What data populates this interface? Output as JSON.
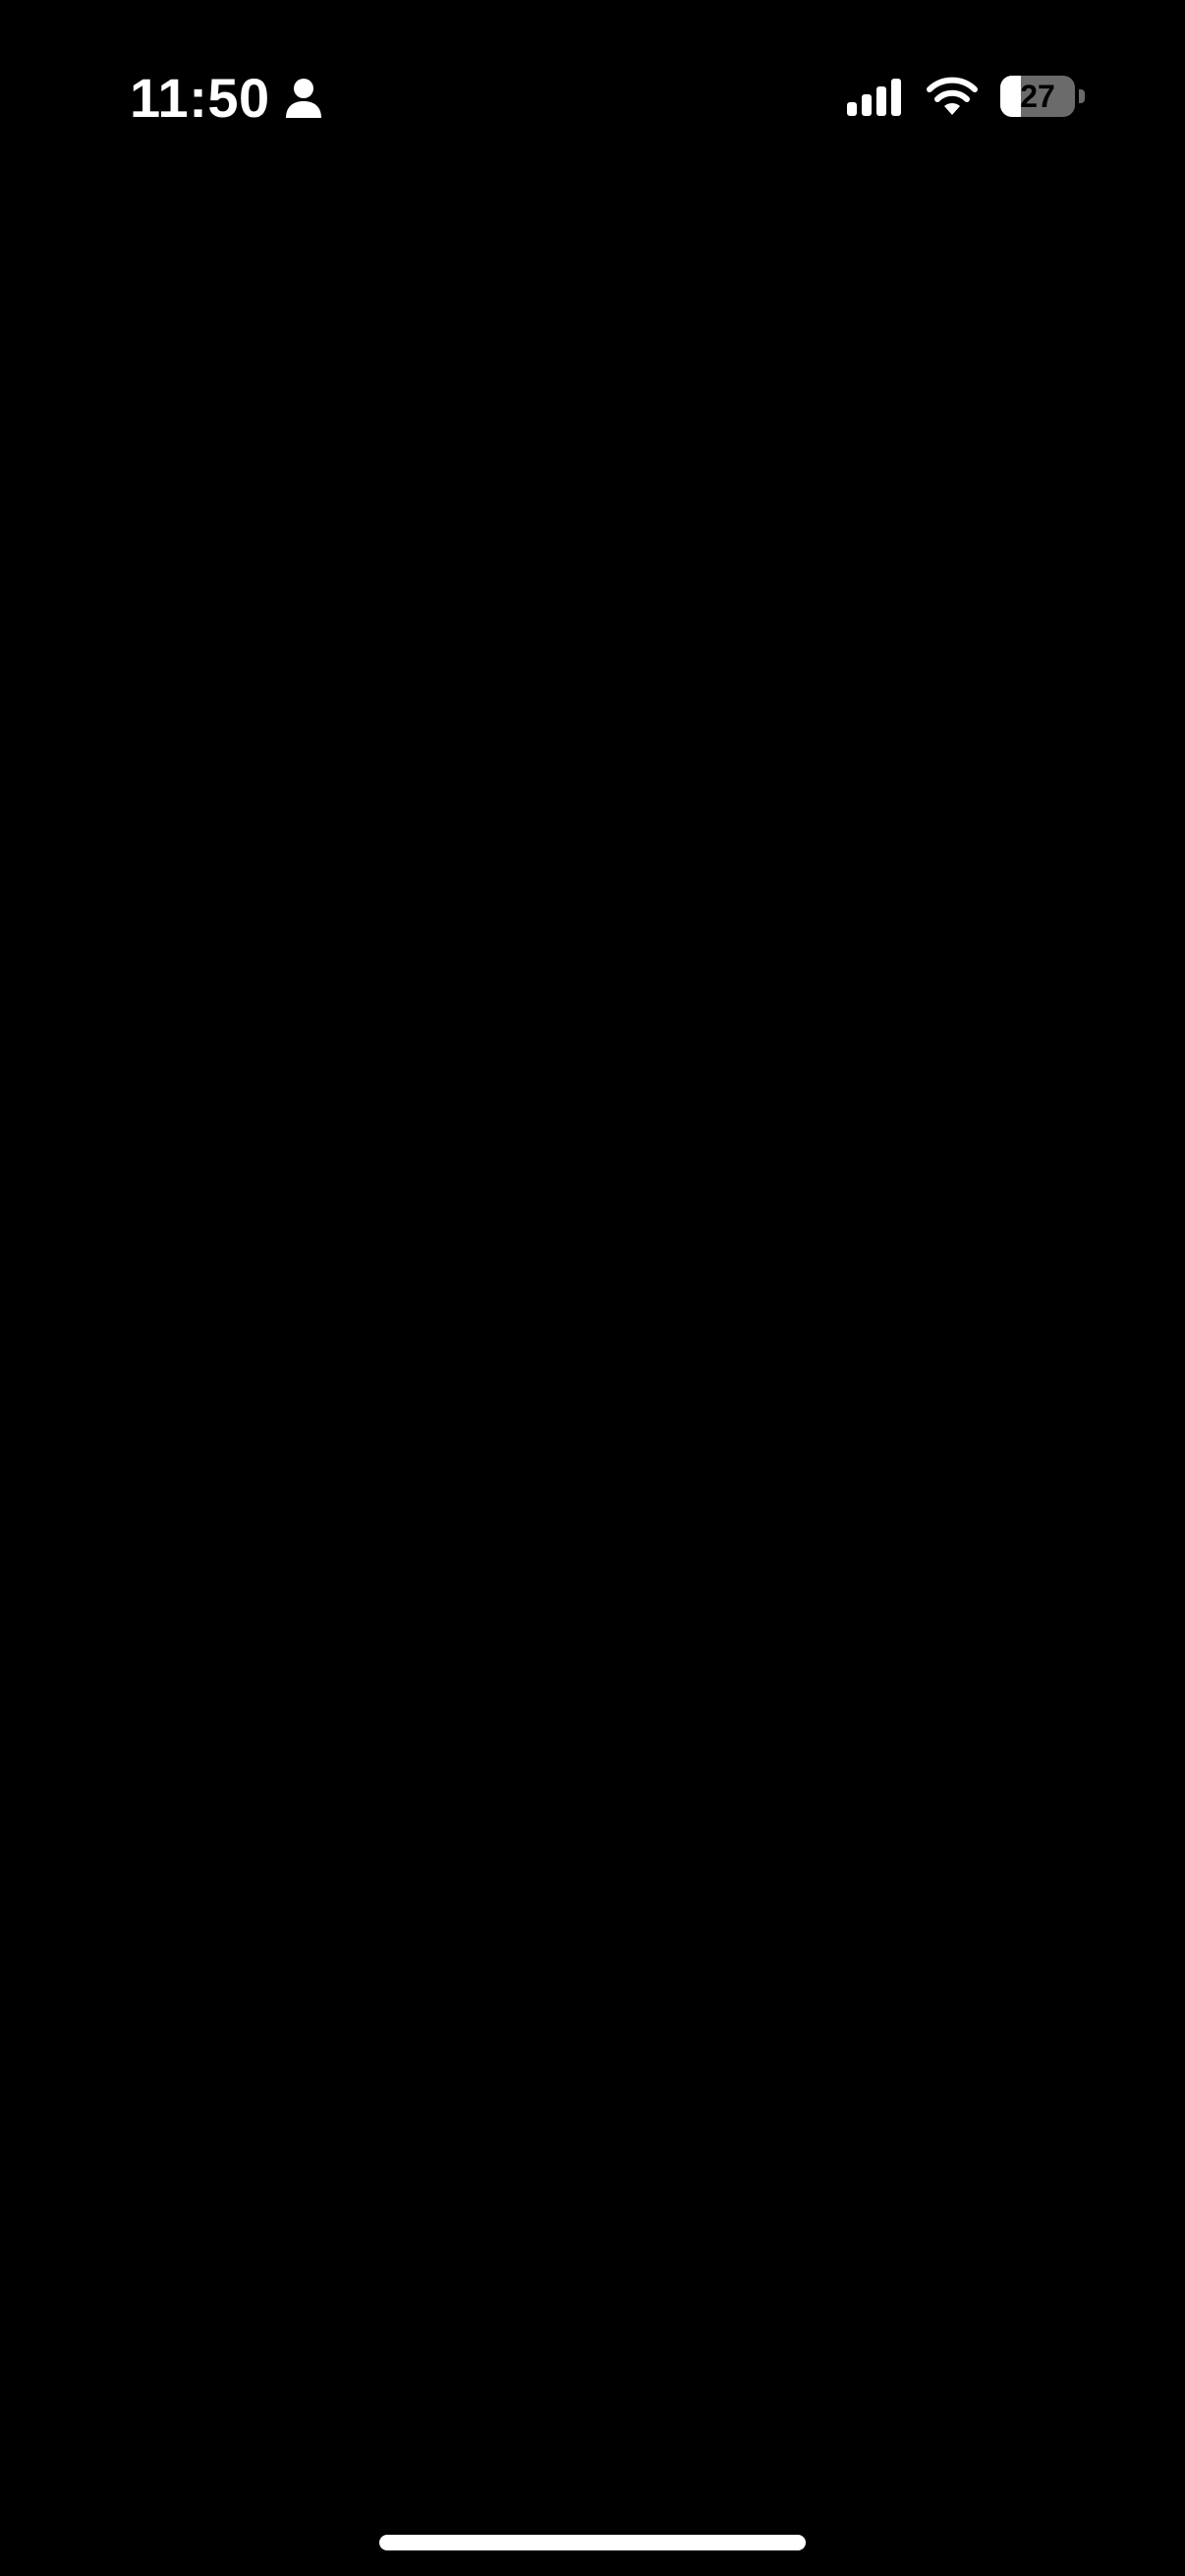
{
  "status_bar": {
    "time": "11:50",
    "battery_level": 27,
    "battery_label": "27",
    "icons": {
      "person": "person-icon",
      "signal": "cellular-signal-icon",
      "wifi": "wifi-icon",
      "battery": "battery-icon"
    }
  },
  "colors": {
    "background": "#000000",
    "foreground": "#ffffff",
    "battery_empty": "#6b6b6b"
  }
}
